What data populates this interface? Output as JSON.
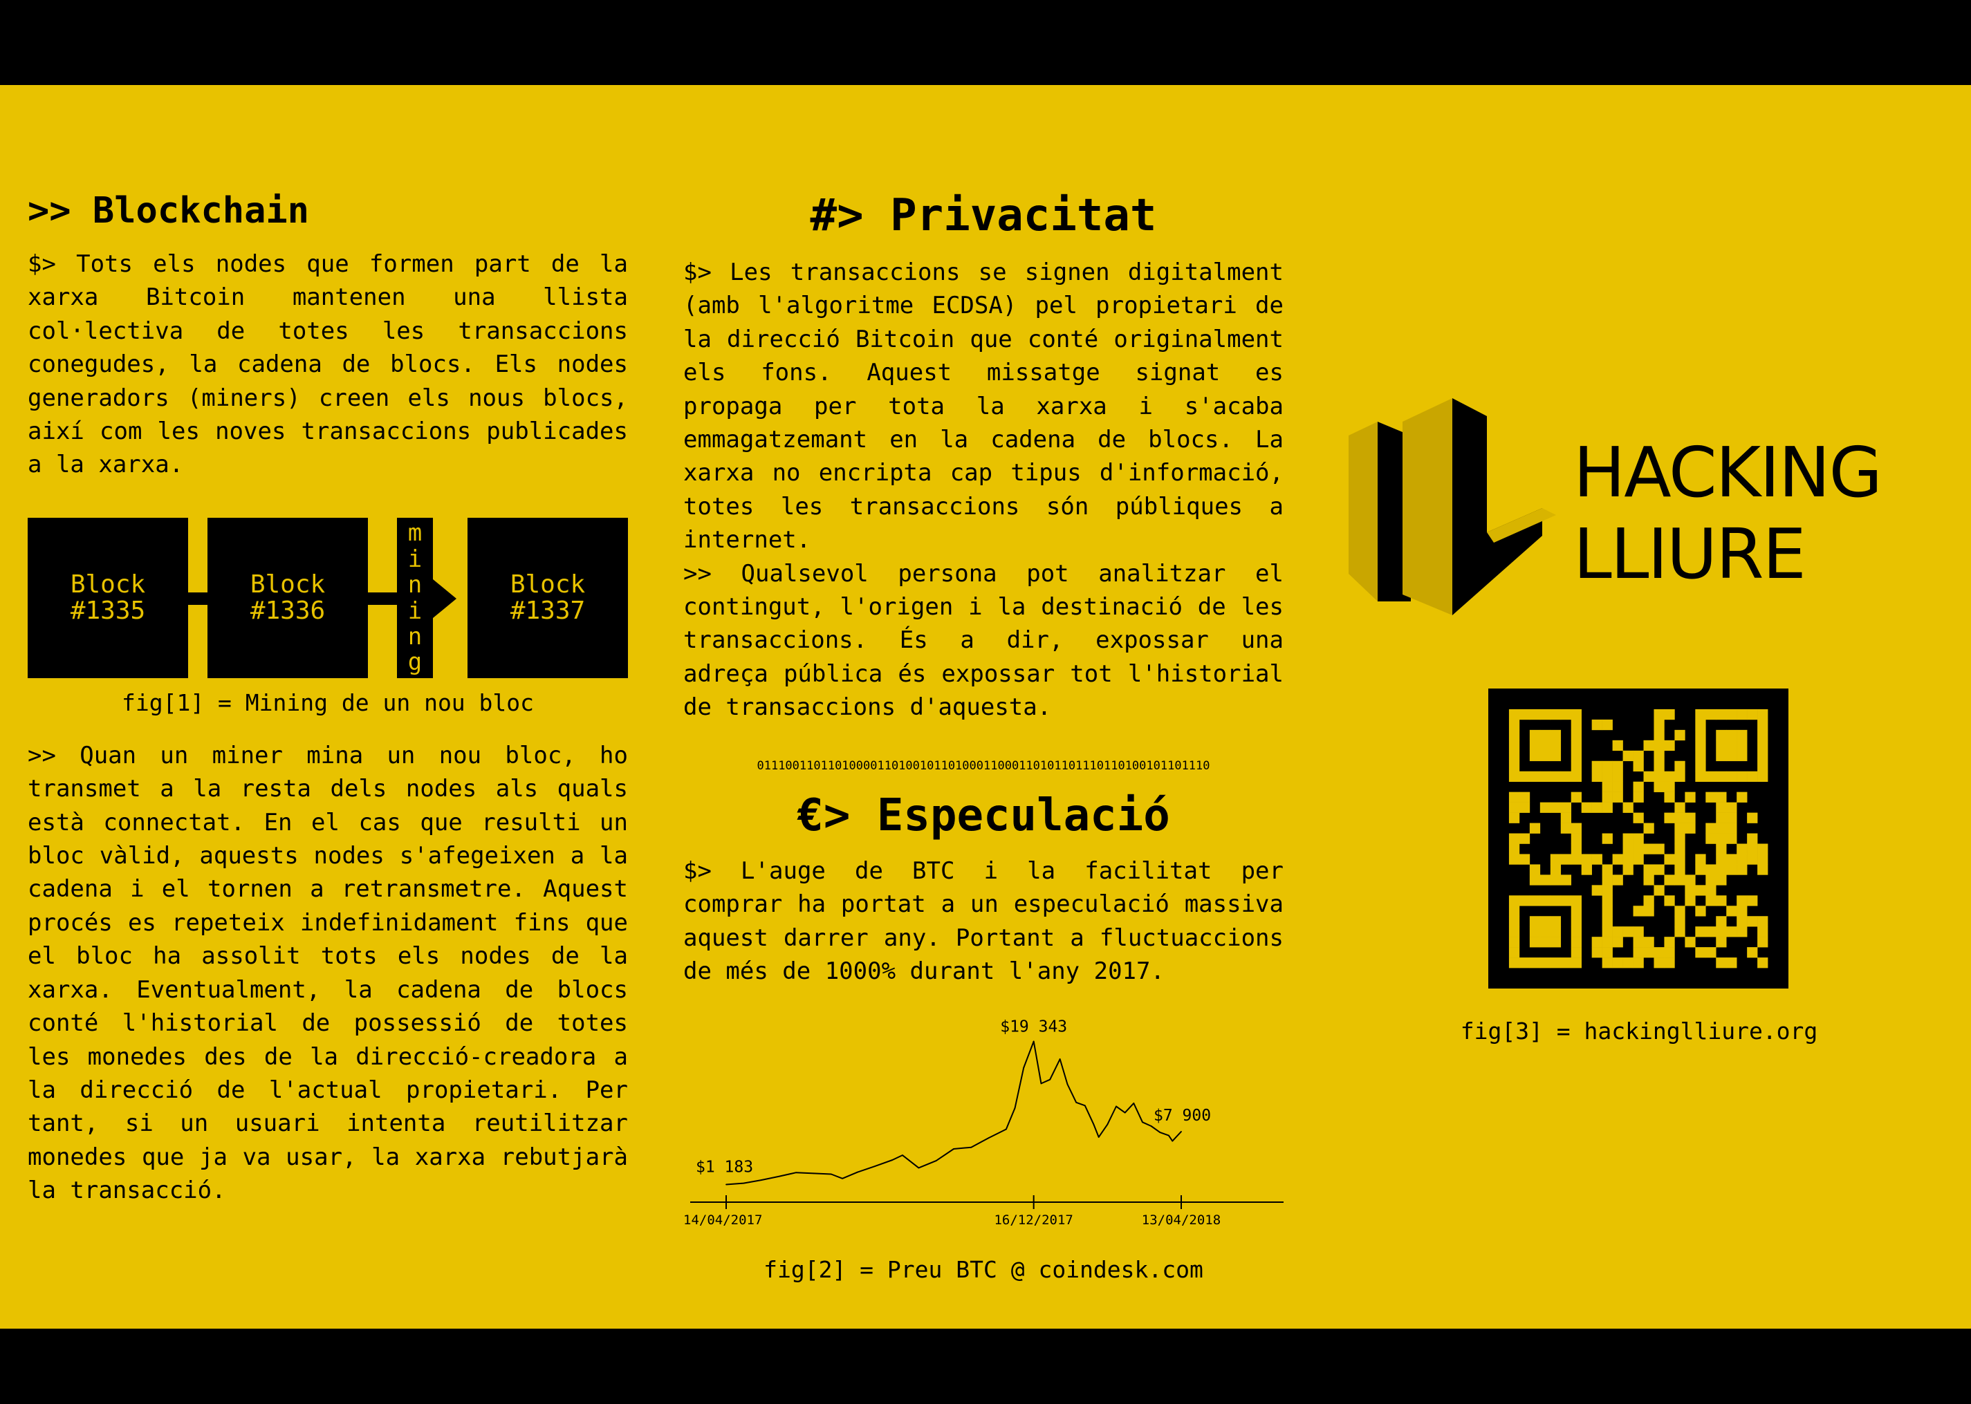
{
  "blockchain": {
    "heading": ">> Blockchain",
    "intro": "$> Tots els nodes que formen part de la xarxa Bitcoin mantenen una llista col·lectiva de totes les transaccions conegudes, la cadena de blocs. Els nodes generadors (miners) creen els nous blocs, així com les noves transaccions publicades a la xarxa.",
    "diagram": {
      "blocks": [
        {
          "line1": "Block",
          "line2": "#1335"
        },
        {
          "line1": "Block",
          "line2": "#1336"
        },
        {
          "line1": "Block",
          "line2": "#1337"
        }
      ],
      "mining_letters": [
        "m",
        "i",
        "n",
        "i",
        "n",
        "g"
      ]
    },
    "fig_caption": "fig[1] = Mining de un nou bloc",
    "body": ">> Quan un miner mina un nou bloc, ho transmet a la resta dels nodes als quals està connectat. En el cas que resulti un bloc vàlid, aquests nodes s'afegeixen a la cadena i el tornen a retransmetre. Aquest procés es repeteix indefinidament fins que el bloc ha assolit tots els nodes de la xarxa. Eventualment, la cadena de blocs conté l'historial de possessió de totes les monedes des de la direcció-creadora a la direcció de l'actual propietari. Per tant, si un usuari intenta reutilitzar monedes que ja va usar, la xarxa rebutjarà la transacció."
  },
  "privacitat": {
    "heading": "#> Privacitat",
    "p1": "$> Les transaccions se signen digitalment (amb l'algoritme ECDSA) pel propietari de la direcció Bitcoin que conté originalment els fons. Aquest missatge signat es propaga per tota la xarxa i s'acaba emmagatzemant en la cadena de blocs. La xarxa no encripta cap tipus d'informació, totes les transaccions són públiques a internet.",
    "p2": ">> Qualsevol persona pot analitzar el contingut, l'origen i la destinació de les transaccions. És a dir, expossar una adreça pública és expossar tot l'historial de transaccions d'aquesta.",
    "binary": "0111001101101000011010010110100011000110101101110110100101101110"
  },
  "especulacio": {
    "heading": "€> Especulació",
    "body": "$> L'auge de BTC i la facilitat per comprar ha portat a un especulació massiva aquest darrer any. Portant a fluctuaccions de més de 1000% durant l'any 2017.",
    "fig_caption": "fig[2] = Preu BTC @ coindesk.com"
  },
  "chart_data": {
    "type": "line",
    "title": "",
    "xlabel": "",
    "ylabel": "",
    "x_tick_labels": [
      "14/04/2017",
      "16/12/2017",
      "13/04/2018"
    ],
    "annotations": [
      {
        "label": "$1 183",
        "x": "2017-04-14",
        "y": 1183
      },
      {
        "label": "$19 343",
        "x": "2017-12-16",
        "y": 19343
      },
      {
        "label": "$7 900",
        "x": "2018-04-13",
        "y": 7900
      }
    ],
    "series": [
      {
        "x": [
          "2017-04-14",
          "2017-04-28",
          "2017-05-12",
          "2017-05-26",
          "2017-06-09",
          "2017-06-23",
          "2017-07-07",
          "2017-07-16",
          "2017-07-28",
          "2017-08-11",
          "2017-08-25",
          "2017-09-02",
          "2017-09-15",
          "2017-09-29",
          "2017-10-13",
          "2017-10-27",
          "2017-11-10",
          "2017-11-24",
          "2017-12-01",
          "2017-12-08",
          "2017-12-16",
          "2017-12-22",
          "2017-12-29",
          "2018-01-06",
          "2018-01-12",
          "2018-01-19",
          "2018-01-26",
          "2018-02-02",
          "2018-02-06",
          "2018-02-13",
          "2018-02-20",
          "2018-02-27",
          "2018-03-06",
          "2018-03-13",
          "2018-03-20",
          "2018-03-27",
          "2018-04-03",
          "2018-04-06",
          "2018-04-13"
        ],
        "values": [
          1183,
          1350,
          1750,
          2200,
          2700,
          2600,
          2500,
          1950,
          2750,
          3500,
          4300,
          4900,
          3300,
          4200,
          5700,
          5900,
          7100,
          8200,
          10900,
          16000,
          19343,
          14000,
          14500,
          17100,
          13900,
          11600,
          11200,
          8800,
          7200,
          8800,
          11100,
          10300,
          11500,
          9100,
          8600,
          7800,
          7400,
          6700,
          7900
        ]
      }
    ],
    "ylim": [
      0,
      20000
    ]
  },
  "logo": {
    "line1": "HACKING",
    "line2": "LLIURE",
    "colors": {
      "dark": "#000000",
      "mid": "#c9a600",
      "light": "#d8b400"
    }
  },
  "qr": {
    "fig_caption": "fig[3] = hackinglliure.org"
  },
  "colors": {
    "background": "#e8c200",
    "ink": "#000000",
    "frame": "#000000"
  }
}
